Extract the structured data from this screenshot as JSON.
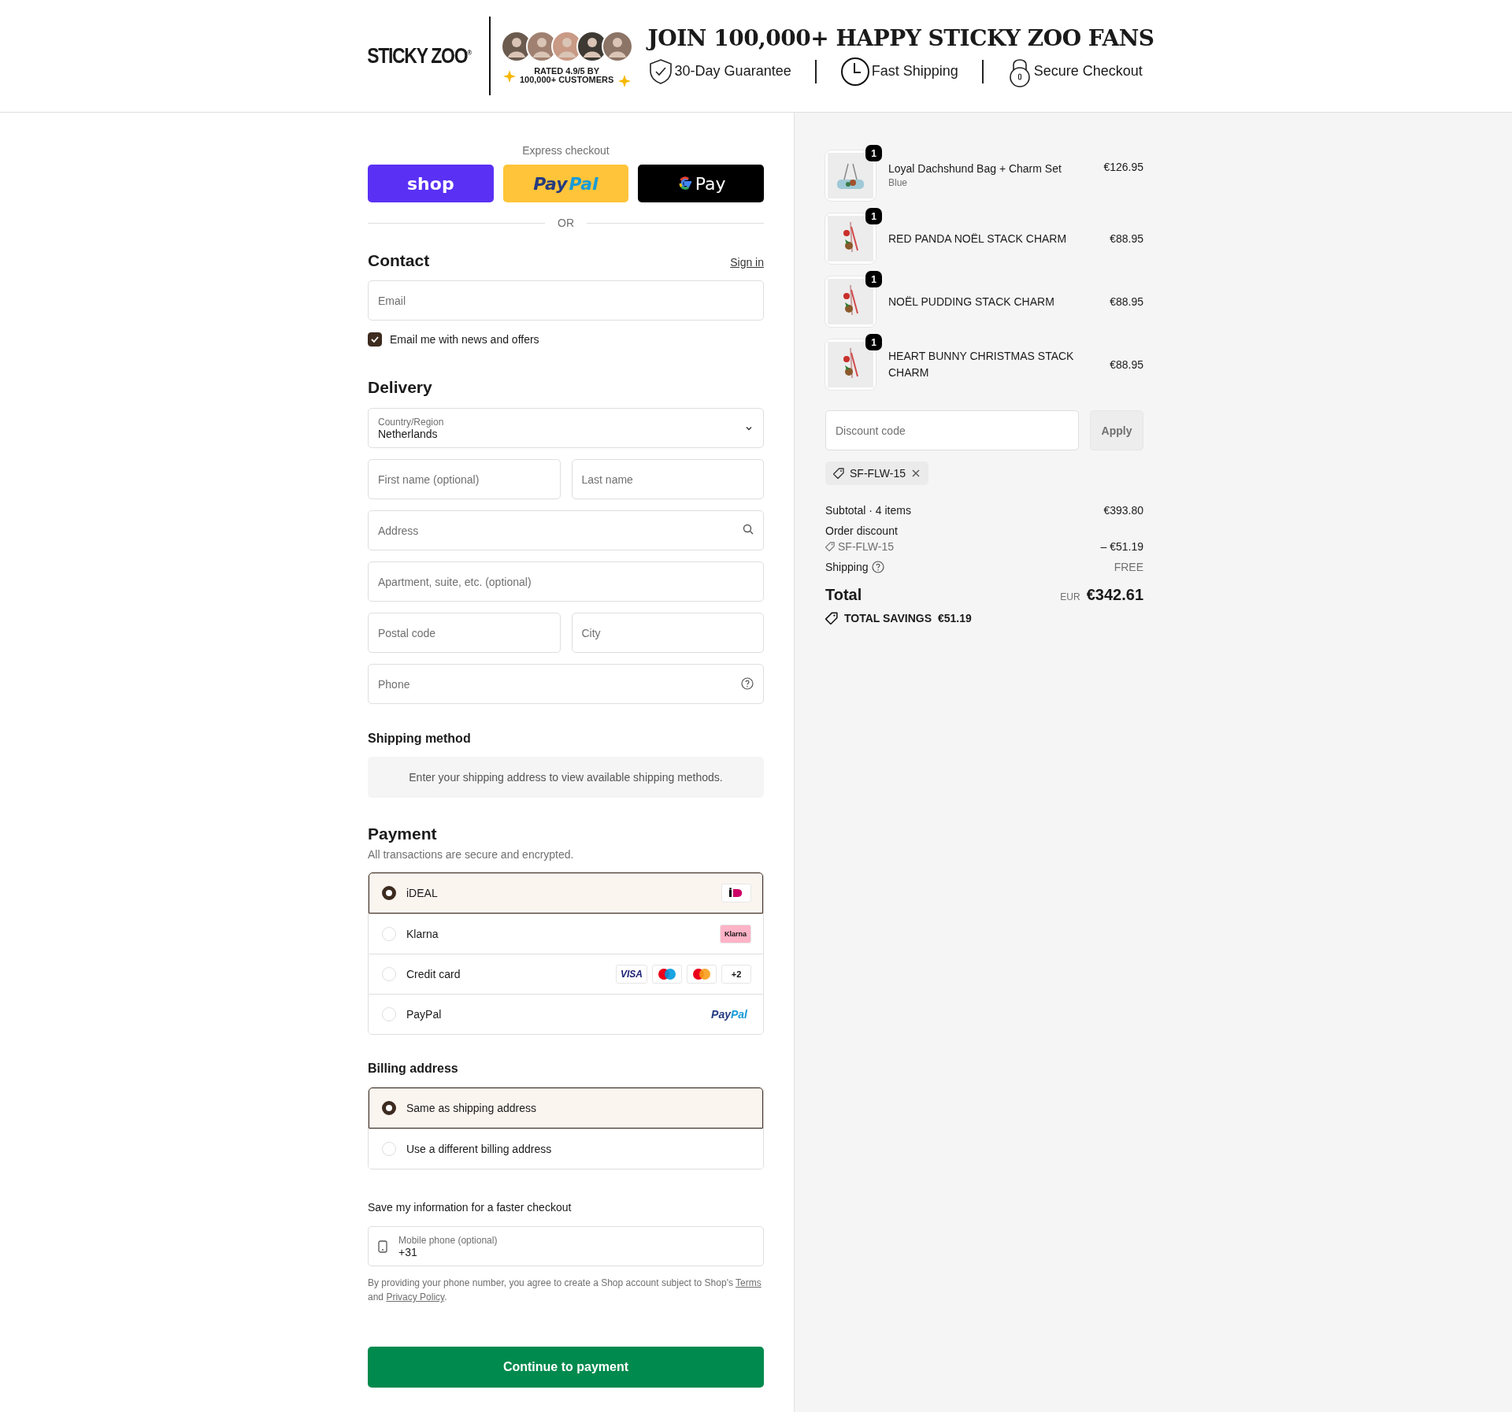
{
  "header": {
    "logo": "STICKY ZOO$^{®}$",
    "rating": "RATED 4.9/5 BY 100,000+ CUSTOMERS",
    "headline": "JOIN 100,000+ HAPPY STICKY ZOO FANS",
    "perks": [
      {
        "kind": "shield",
        "label": "30-Day Guarantee"
      },
      {
        "kind": "clock",
        "label": "Fast Shipping"
      },
      {
        "kind": "lock",
        "label": "Secure Checkout"
      }
    ]
  },
  "express": {
    "title": "Express checkout",
    "buttons": [
      {
        "kind": "shop",
        "parts": [
          "shop"
        ]
      },
      {
        "kind": "paypal",
        "parts": [
          "Pay",
          "Pal"
        ]
      },
      {
        "kind": "gpay",
        "parts": [
          "Pay"
        ]
      }
    ],
    "divider": "OR"
  },
  "contact": {
    "title": "Contact",
    "sign_in": "Sign in",
    "email_placeholder": "Email",
    "newsletter": {
      "label": "Email me with news and offers",
      "checked": true
    }
  },
  "delivery": {
    "title": "Delivery",
    "country": {
      "label": "Country/Region",
      "value": "Netherlands"
    },
    "rows": [
      [
        {
          "placeholder": "First name (optional)"
        },
        {
          "placeholder": "Last name"
        }
      ],
      [
        {
          "placeholder": "Address",
          "kind": "search"
        }
      ],
      [
        {
          "placeholder": "Apartment, suite, etc. (optional)"
        }
      ],
      [
        {
          "placeholder": "Postal code"
        },
        {
          "placeholder": "City"
        }
      ],
      [
        {
          "placeholder": "Phone",
          "kind": "help"
        }
      ]
    ]
  },
  "shipping_method": {
    "title": "Shipping method",
    "notice": "Enter your shipping address to view available shipping methods."
  },
  "payment": {
    "title": "Payment",
    "subtitle": "All transactions are secure and encrypted.",
    "methods": [
      {
        "label": "iDEAL",
        "selected": true,
        "logos": [
          {
            "kind": "ideal"
          }
        ]
      },
      {
        "label": "Klarna",
        "selected": false,
        "logos": [
          {
            "kind": "klarna",
            "text": "Klarna"
          }
        ]
      },
      {
        "label": "Credit card",
        "selected": false,
        "logos": [
          {
            "kind": "visa",
            "text": "VISA"
          },
          {
            "kind": "maestro"
          },
          {
            "kind": "mastercard"
          },
          {
            "kind": "more",
            "text": "+2"
          }
        ]
      },
      {
        "label": "PayPal",
        "selected": false,
        "logos": [
          {
            "kind": "paypal",
            "parts": [
              "Pay",
              "Pal"
            ]
          }
        ]
      }
    ]
  },
  "billing": {
    "title": "Billing address",
    "options": [
      {
        "label": "Same as shipping address",
        "selected": true
      },
      {
        "label": "Use a different billing address",
        "selected": false
      }
    ]
  },
  "save_info": {
    "title": "Save my information for a faster checkout",
    "phone_label": "Mobile phone (optional)",
    "phone_value": "+31",
    "legal": "By providing your phone number, you agree to create a Shop account subject to Shop's",
    "terms": "Terms",
    "and": "and",
    "privacy": "Privacy Policy",
    "end": "."
  },
  "continue_button": "Continue to payment",
  "cart": {
    "items": [
      {
        "name": "Loyal Dachshund Bag + Charm Set",
        "variant": "Blue",
        "price": "€126.95",
        "quantity": "1",
        "kind": "bag"
      },
      {
        "name": "RED PANDA NOËL STACK CHARM",
        "price": "€88.95",
        "quantity": "1",
        "kind": "charm"
      },
      {
        "name": "NOËL PUDDING STACK CHARM",
        "price": "€88.95",
        "quantity": "1",
        "kind": "charm"
      },
      {
        "name": "HEART BUNNY CHRISTMAS STACK CHARM",
        "price": "€88.95",
        "quantity": "1",
        "kind": "charm"
      }
    ],
    "discount_placeholder": "Discount code",
    "apply": "Apply",
    "applied_code": "SF-FLW-15",
    "subtotal": {
      "label": "Subtotal · 4 items",
      "value": "€393.80"
    },
    "discount": {
      "label": "Order discount",
      "code": "SF-FLW-15",
      "value": "– €51.19"
    },
    "shipping": {
      "label": "Shipping",
      "value": "FREE"
    },
    "total": {
      "label": "Total",
      "currency": "EUR",
      "value": "€342.61"
    },
    "savings": {
      "label": "TOTAL SAVINGS",
      "value": "€51.19"
    }
  }
}
